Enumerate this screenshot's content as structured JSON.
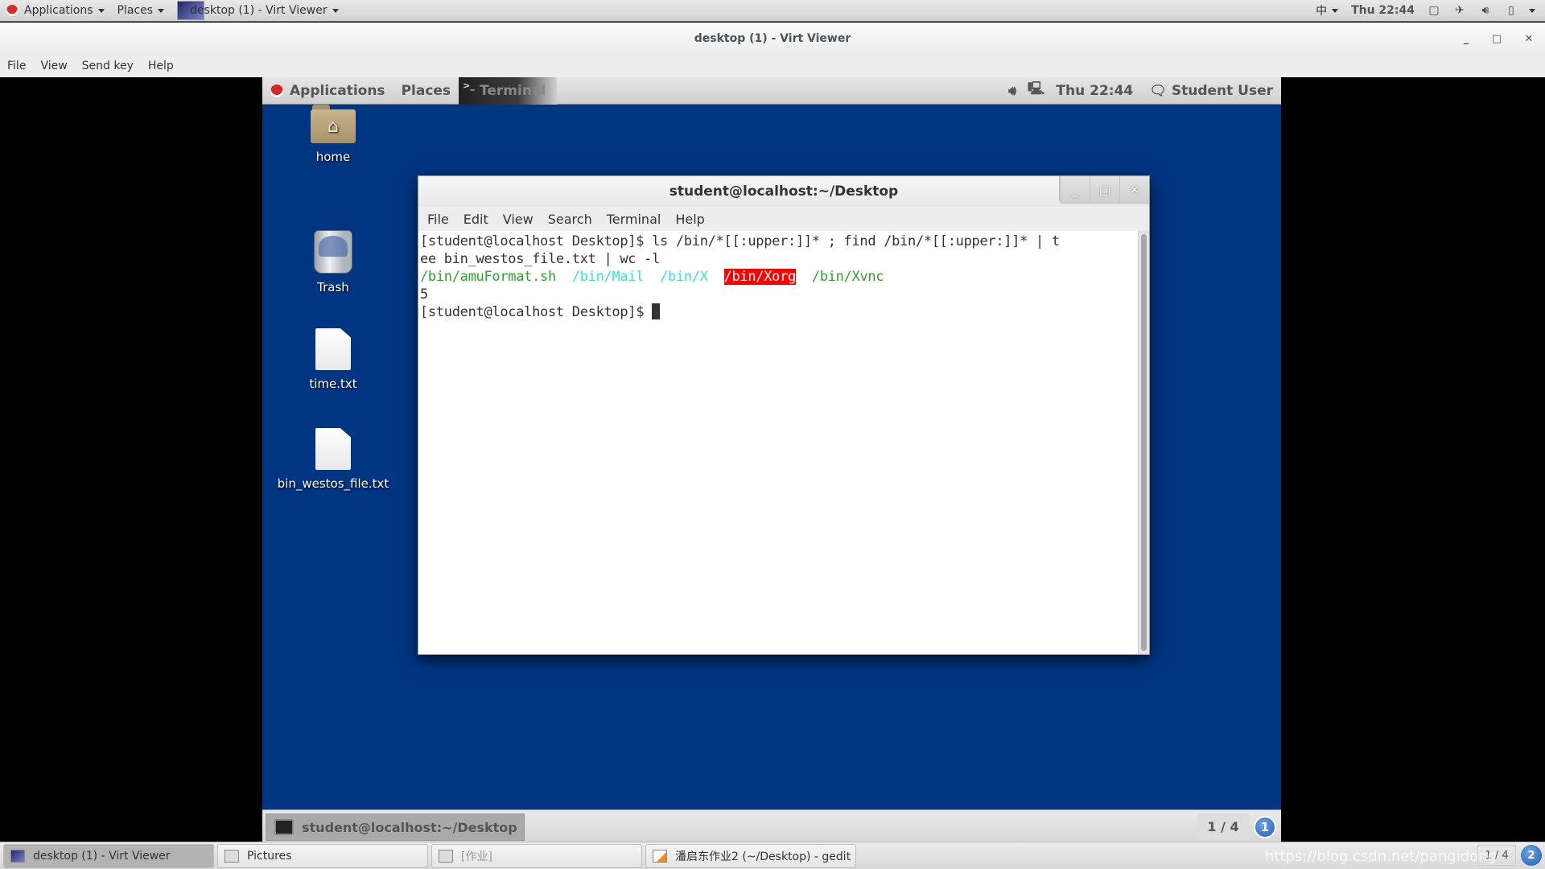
{
  "host_panel": {
    "applications": "Applications",
    "places": "Places",
    "active_window": "desktop (1) - Virt Viewer",
    "input_method": "中",
    "clock": "Thu 22:44"
  },
  "virt_viewer": {
    "title": "desktop (1) - Virt Viewer",
    "menu": [
      "File",
      "View",
      "Send key",
      "Help"
    ]
  },
  "guest_panel": {
    "applications": "Applications",
    "places": "Places",
    "active_app": "Terminal",
    "clock": "Thu 22:44",
    "user": "Student User"
  },
  "desktop_icons": [
    {
      "label": "home",
      "icon": "home-folder-icon"
    },
    {
      "label": "Trash",
      "icon": "trash-icon"
    },
    {
      "label": "time.txt",
      "icon": "text-file-icon"
    },
    {
      "label": "bin_westos_file.txt",
      "icon": "text-file-icon"
    }
  ],
  "terminal": {
    "title": "student@localhost:~/Desktop",
    "menu": [
      "File",
      "Edit",
      "View",
      "Search",
      "Terminal",
      "Help"
    ],
    "prompt": "[student@localhost Desktop]$ ",
    "command_line1": "ls /bin/*[[:upper:]]* ; find /bin/*[[:upper:]]* | t",
    "command_line2": "ee bin_westos_file.txt | wc -l",
    "ls_output": [
      {
        "text": "/bin/amuFormat.sh",
        "color": "green"
      },
      {
        "text": "/bin/Mail",
        "color": "cyan"
      },
      {
        "text": "/bin/X",
        "color": "cyan"
      },
      {
        "text": "/bin/Xorg",
        "color": "red-bg"
      },
      {
        "text": "/bin/Xvnc",
        "color": "green"
      }
    ],
    "count_output": "5"
  },
  "guest_bottom": {
    "task": "student@localhost:~/Desktop",
    "workspace": "1 / 4",
    "notifications": "1"
  },
  "host_taskbar": {
    "tasks": [
      {
        "label": "desktop (1) - Virt Viewer",
        "active": true
      },
      {
        "label": "Pictures",
        "active": false
      },
      {
        "label": "[作业]",
        "active": false
      },
      {
        "label": "潘启东作业2 (~/Desktop) - gedit",
        "active": false
      }
    ],
    "watermark": "https://blog.csdn.net/pangidong",
    "workspace": "1 / 4",
    "notifications": "2"
  }
}
